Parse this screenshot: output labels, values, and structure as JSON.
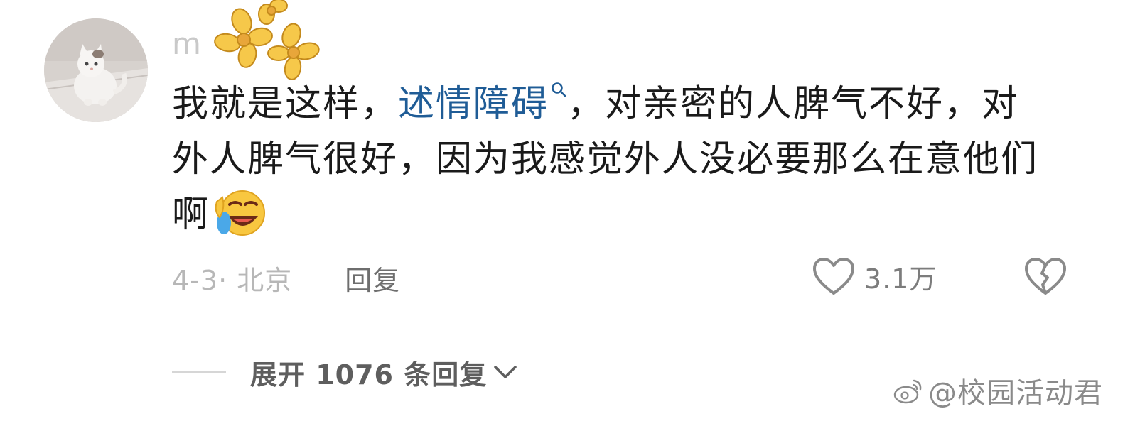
{
  "comment": {
    "username": "m",
    "text_before": "我就是这样，",
    "keyword": "述情障碍",
    "text_after": "，对亲密的人脾气不好，对外人脾气很好，因为我感觉外人没必要那么在意他们啊",
    "emoji": "laughing-crying-emoji",
    "date_location": "4-3· 北京",
    "reply_label": "回复",
    "like_count": "3.1万"
  },
  "replies": {
    "expand_label": "展开 1076 条回复"
  },
  "watermark": {
    "text": "@校园活动君"
  },
  "colors": {
    "text": "#1a1a1a",
    "link": "#1f5c96",
    "muted": "#b7b7b7",
    "sticker_yellow": "#f6c84a",
    "sticker_outline": "#c48a1c"
  }
}
